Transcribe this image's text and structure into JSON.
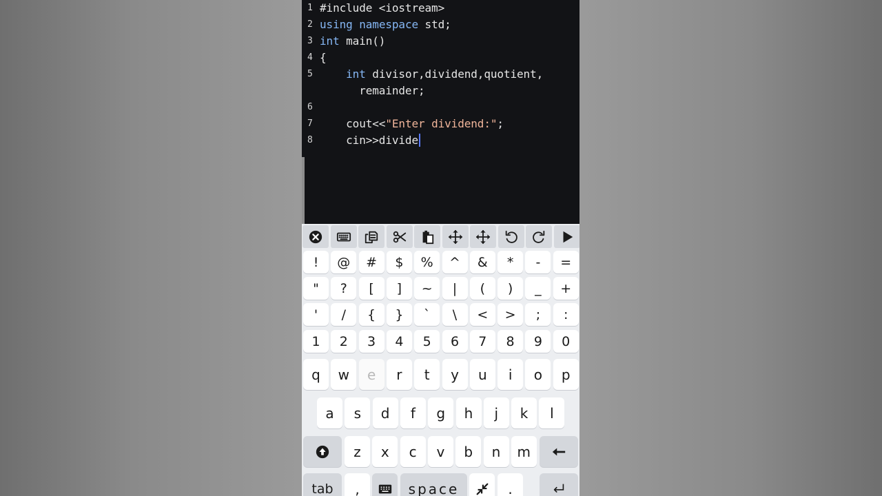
{
  "editor": {
    "lines": [
      {
        "number": "1",
        "segments": [
          {
            "text": "#include <iostream>",
            "cls": ""
          }
        ]
      },
      {
        "number": "2",
        "segments": [
          {
            "text": "using",
            "cls": "kw"
          },
          {
            "text": " ",
            "cls": ""
          },
          {
            "text": "namespace",
            "cls": "kw"
          },
          {
            "text": " std;",
            "cls": ""
          }
        ]
      },
      {
        "number": "3",
        "segments": [
          {
            "text": "int",
            "cls": "kw"
          },
          {
            "text": " main()",
            "cls": ""
          }
        ]
      },
      {
        "number": "4",
        "segments": [
          {
            "text": "{",
            "cls": ""
          }
        ]
      },
      {
        "number": "5",
        "segments": [
          {
            "text": "    ",
            "cls": ""
          },
          {
            "text": "int",
            "cls": "kw"
          },
          {
            "text": " divisor,dividend,quotient,",
            "cls": ""
          }
        ]
      },
      {
        "number": "",
        "segments": [
          {
            "text": "      remainder;",
            "cls": ""
          }
        ]
      },
      {
        "number": "6",
        "segments": [
          {
            "text": "",
            "cls": ""
          }
        ]
      },
      {
        "number": "7",
        "segments": [
          {
            "text": "    cout<<",
            "cls": ""
          },
          {
            "text": "\"Enter dividend:\"",
            "cls": "str"
          },
          {
            "text": ";",
            "cls": ""
          }
        ]
      },
      {
        "number": "8",
        "segments": [
          {
            "text": "    cin>>divide",
            "cls": ""
          }
        ],
        "caret": true
      }
    ]
  },
  "toolbar": {
    "buttons": [
      {
        "name": "close-icon",
        "glyph": "close"
      },
      {
        "name": "keyboard-icon",
        "glyph": "keyboard"
      },
      {
        "name": "copy-icon",
        "glyph": "copy"
      },
      {
        "name": "cut-icon",
        "glyph": "cut"
      },
      {
        "name": "paste-icon",
        "glyph": "paste"
      },
      {
        "name": "move-cursor-icon",
        "glyph": "move"
      },
      {
        "name": "select-move-icon",
        "glyph": "move"
      },
      {
        "name": "undo-icon",
        "glyph": "undo"
      },
      {
        "name": "redo-icon",
        "glyph": "redo"
      },
      {
        "name": "run-icon",
        "glyph": "run"
      }
    ]
  },
  "keyboard": {
    "symbol_rows": [
      [
        "!",
        "@",
        "#",
        "$",
        "%",
        "^",
        "&",
        "*",
        "-",
        "="
      ],
      [
        "\"",
        "?",
        "[",
        "]",
        "~",
        "|",
        "(",
        ")",
        "_",
        "+"
      ],
      [
        "'",
        "/",
        "{",
        "}",
        "`",
        "\\",
        "<",
        ">",
        ";",
        ":"
      ],
      [
        "1",
        "2",
        "3",
        "4",
        "5",
        "6",
        "7",
        "8",
        "9",
        "0"
      ]
    ],
    "alpha_row_1": [
      "q",
      "w",
      "e",
      "r",
      "t",
      "y",
      "u",
      "i",
      "o",
      "p"
    ],
    "alpha_row_2": [
      "a",
      "s",
      "d",
      "f",
      "g",
      "h",
      "j",
      "k",
      "l"
    ],
    "alpha_row_3": [
      "z",
      "x",
      "c",
      "v",
      "b",
      "n",
      "m"
    ],
    "pressed_key": "e",
    "bottom": {
      "tab_label": "tab",
      "comma_label": ",",
      "space_label": "space",
      "period_label": "."
    }
  }
}
